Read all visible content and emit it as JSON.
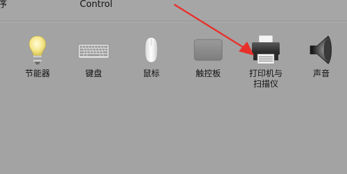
{
  "previous_row": {
    "left_fragment": "序",
    "center_text": "Control"
  },
  "preferences": [
    {
      "id": "energy",
      "label": "节能器",
      "icon": "lightbulb-icon"
    },
    {
      "id": "keyboard",
      "label": "键盘",
      "icon": "keyboard-icon"
    },
    {
      "id": "mouse",
      "label": "鼠标",
      "icon": "mouse-icon"
    },
    {
      "id": "trackpad",
      "label": "触控板",
      "icon": "trackpad-icon"
    },
    {
      "id": "printers",
      "label": "打印机与\n扫描仪",
      "icon": "printer-icon"
    },
    {
      "id": "sound",
      "label": "声音",
      "icon": "speaker-icon"
    }
  ],
  "annotation": {
    "arrow_color": "#e8302a",
    "points_to": "printers"
  }
}
